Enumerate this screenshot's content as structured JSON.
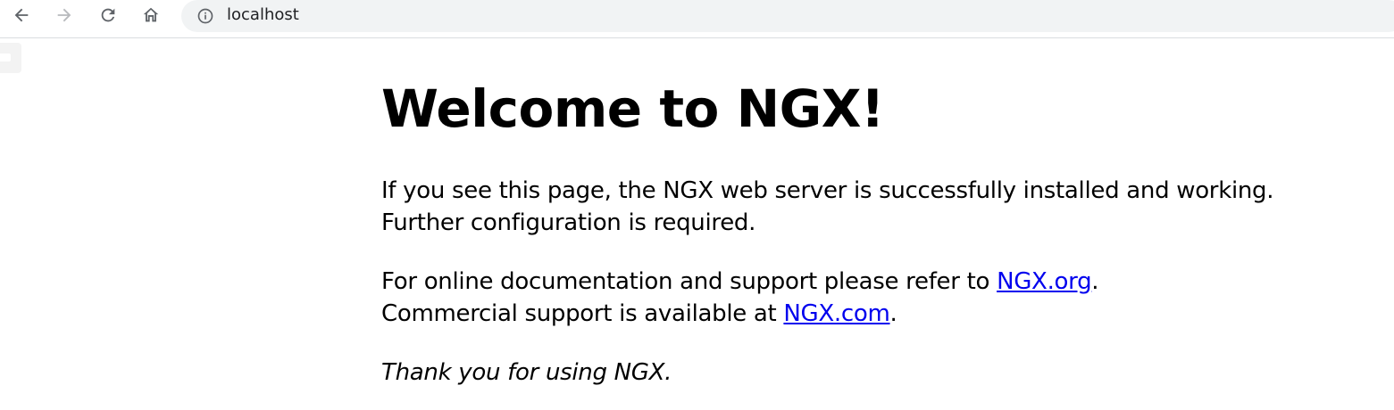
{
  "browser": {
    "url": "localhost",
    "icons": {
      "back": "arrow-left-icon",
      "forward": "arrow-right-icon",
      "reload": "reload-icon",
      "home": "home-icon",
      "site_info": "info-circle-icon"
    },
    "forward_disabled": true
  },
  "page": {
    "heading": "Welcome to NGX!",
    "para1_line1": "If you see this page, the NGX web server is successfully installed and working.",
    "para1_line2": "Further configuration is required.",
    "para2_line1_prefix": "For online documentation and support please refer to ",
    "para2_link1": "NGX.org",
    "para2_line1_suffix": ".",
    "para2_line2_prefix": "Commercial support is available at ",
    "para2_link2": "NGX.com",
    "para2_line2_suffix": ".",
    "para3": "Thank you for using NGX."
  },
  "colors": {
    "link": "#0000ee",
    "omnibox_bg": "#f1f3f4",
    "icon": "#5f6368",
    "icon_disabled": "#b8babd"
  }
}
